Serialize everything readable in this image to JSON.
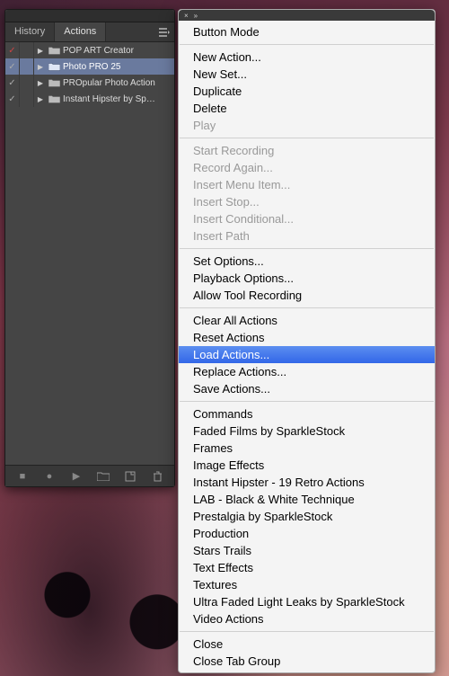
{
  "tabs": {
    "history": "History",
    "actions": "Actions"
  },
  "actionSets": [
    {
      "name": "POP ART Creator",
      "checkColor": "red",
      "selected": false
    },
    {
      "name": "Photo PRO 25",
      "checkColor": "normal",
      "selected": true
    },
    {
      "name": "PROpular Photo Action",
      "checkColor": "normal",
      "selected": false
    },
    {
      "name": "Instant Hipster by Sp…",
      "checkColor": "normal",
      "selected": false
    }
  ],
  "footer": {
    "stop": "■",
    "record": "●",
    "play": "▶",
    "newSet": "folder",
    "newAction": "page",
    "delete": "trash"
  },
  "menu": {
    "groups": [
      [
        {
          "label": "Button Mode",
          "disabled": false
        }
      ],
      [
        {
          "label": "New Action...",
          "disabled": false
        },
        {
          "label": "New Set...",
          "disabled": false
        },
        {
          "label": "Duplicate",
          "disabled": false
        },
        {
          "label": "Delete",
          "disabled": false
        },
        {
          "label": "Play",
          "disabled": true
        }
      ],
      [
        {
          "label": "Start Recording",
          "disabled": true
        },
        {
          "label": "Record Again...",
          "disabled": true
        },
        {
          "label": "Insert Menu Item...",
          "disabled": true
        },
        {
          "label": "Insert Stop...",
          "disabled": true
        },
        {
          "label": "Insert Conditional...",
          "disabled": true
        },
        {
          "label": "Insert Path",
          "disabled": true
        }
      ],
      [
        {
          "label": "Set Options...",
          "disabled": false
        },
        {
          "label": "Playback Options...",
          "disabled": false
        },
        {
          "label": "Allow Tool Recording",
          "disabled": false
        }
      ],
      [
        {
          "label": "Clear All Actions",
          "disabled": false
        },
        {
          "label": "Reset Actions",
          "disabled": false
        },
        {
          "label": "Load Actions...",
          "disabled": false,
          "highlighted": true
        },
        {
          "label": "Replace Actions...",
          "disabled": false
        },
        {
          "label": "Save Actions...",
          "disabled": false
        }
      ],
      [
        {
          "label": "Commands",
          "disabled": false
        },
        {
          "label": "Faded Films by SparkleStock",
          "disabled": false
        },
        {
          "label": "Frames",
          "disabled": false
        },
        {
          "label": "Image Effects",
          "disabled": false
        },
        {
          "label": "Instant Hipster - 19 Retro Actions",
          "disabled": false
        },
        {
          "label": "LAB - Black & White Technique",
          "disabled": false
        },
        {
          "label": "Prestalgia by SparkleStock",
          "disabled": false
        },
        {
          "label": "Production",
          "disabled": false
        },
        {
          "label": "Stars Trails",
          "disabled": false
        },
        {
          "label": "Text Effects",
          "disabled": false
        },
        {
          "label": "Textures",
          "disabled": false
        },
        {
          "label": "Ultra Faded Light Leaks by SparkleStock",
          "disabled": false
        },
        {
          "label": "Video Actions",
          "disabled": false
        }
      ],
      [
        {
          "label": "Close",
          "disabled": false
        },
        {
          "label": "Close Tab Group",
          "disabled": false
        }
      ]
    ]
  }
}
